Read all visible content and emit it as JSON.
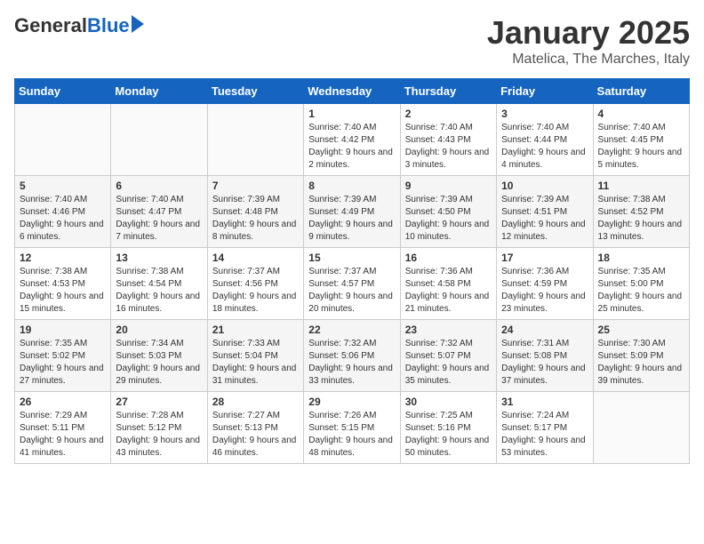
{
  "header": {
    "logo_general": "General",
    "logo_blue": "Blue",
    "month": "January 2025",
    "location": "Matelica, The Marches, Italy"
  },
  "weekdays": [
    "Sunday",
    "Monday",
    "Tuesday",
    "Wednesday",
    "Thursday",
    "Friday",
    "Saturday"
  ],
  "weeks": [
    [
      {
        "day": "",
        "info": ""
      },
      {
        "day": "",
        "info": ""
      },
      {
        "day": "",
        "info": ""
      },
      {
        "day": "1",
        "info": "Sunrise: 7:40 AM\nSunset: 4:42 PM\nDaylight: 9 hours and 2 minutes."
      },
      {
        "day": "2",
        "info": "Sunrise: 7:40 AM\nSunset: 4:43 PM\nDaylight: 9 hours and 3 minutes."
      },
      {
        "day": "3",
        "info": "Sunrise: 7:40 AM\nSunset: 4:44 PM\nDaylight: 9 hours and 4 minutes."
      },
      {
        "day": "4",
        "info": "Sunrise: 7:40 AM\nSunset: 4:45 PM\nDaylight: 9 hours and 5 minutes."
      }
    ],
    [
      {
        "day": "5",
        "info": "Sunrise: 7:40 AM\nSunset: 4:46 PM\nDaylight: 9 hours and 6 minutes."
      },
      {
        "day": "6",
        "info": "Sunrise: 7:40 AM\nSunset: 4:47 PM\nDaylight: 9 hours and 7 minutes."
      },
      {
        "day": "7",
        "info": "Sunrise: 7:39 AM\nSunset: 4:48 PM\nDaylight: 9 hours and 8 minutes."
      },
      {
        "day": "8",
        "info": "Sunrise: 7:39 AM\nSunset: 4:49 PM\nDaylight: 9 hours and 9 minutes."
      },
      {
        "day": "9",
        "info": "Sunrise: 7:39 AM\nSunset: 4:50 PM\nDaylight: 9 hours and 10 minutes."
      },
      {
        "day": "10",
        "info": "Sunrise: 7:39 AM\nSunset: 4:51 PM\nDaylight: 9 hours and 12 minutes."
      },
      {
        "day": "11",
        "info": "Sunrise: 7:38 AM\nSunset: 4:52 PM\nDaylight: 9 hours and 13 minutes."
      }
    ],
    [
      {
        "day": "12",
        "info": "Sunrise: 7:38 AM\nSunset: 4:53 PM\nDaylight: 9 hours and 15 minutes."
      },
      {
        "day": "13",
        "info": "Sunrise: 7:38 AM\nSunset: 4:54 PM\nDaylight: 9 hours and 16 minutes."
      },
      {
        "day": "14",
        "info": "Sunrise: 7:37 AM\nSunset: 4:56 PM\nDaylight: 9 hours and 18 minutes."
      },
      {
        "day": "15",
        "info": "Sunrise: 7:37 AM\nSunset: 4:57 PM\nDaylight: 9 hours and 20 minutes."
      },
      {
        "day": "16",
        "info": "Sunrise: 7:36 AM\nSunset: 4:58 PM\nDaylight: 9 hours and 21 minutes."
      },
      {
        "day": "17",
        "info": "Sunrise: 7:36 AM\nSunset: 4:59 PM\nDaylight: 9 hours and 23 minutes."
      },
      {
        "day": "18",
        "info": "Sunrise: 7:35 AM\nSunset: 5:00 PM\nDaylight: 9 hours and 25 minutes."
      }
    ],
    [
      {
        "day": "19",
        "info": "Sunrise: 7:35 AM\nSunset: 5:02 PM\nDaylight: 9 hours and 27 minutes."
      },
      {
        "day": "20",
        "info": "Sunrise: 7:34 AM\nSunset: 5:03 PM\nDaylight: 9 hours and 29 minutes."
      },
      {
        "day": "21",
        "info": "Sunrise: 7:33 AM\nSunset: 5:04 PM\nDaylight: 9 hours and 31 minutes."
      },
      {
        "day": "22",
        "info": "Sunrise: 7:32 AM\nSunset: 5:06 PM\nDaylight: 9 hours and 33 minutes."
      },
      {
        "day": "23",
        "info": "Sunrise: 7:32 AM\nSunset: 5:07 PM\nDaylight: 9 hours and 35 minutes."
      },
      {
        "day": "24",
        "info": "Sunrise: 7:31 AM\nSunset: 5:08 PM\nDaylight: 9 hours and 37 minutes."
      },
      {
        "day": "25",
        "info": "Sunrise: 7:30 AM\nSunset: 5:09 PM\nDaylight: 9 hours and 39 minutes."
      }
    ],
    [
      {
        "day": "26",
        "info": "Sunrise: 7:29 AM\nSunset: 5:11 PM\nDaylight: 9 hours and 41 minutes."
      },
      {
        "day": "27",
        "info": "Sunrise: 7:28 AM\nSunset: 5:12 PM\nDaylight: 9 hours and 43 minutes."
      },
      {
        "day": "28",
        "info": "Sunrise: 7:27 AM\nSunset: 5:13 PM\nDaylight: 9 hours and 46 minutes."
      },
      {
        "day": "29",
        "info": "Sunrise: 7:26 AM\nSunset: 5:15 PM\nDaylight: 9 hours and 48 minutes."
      },
      {
        "day": "30",
        "info": "Sunrise: 7:25 AM\nSunset: 5:16 PM\nDaylight: 9 hours and 50 minutes."
      },
      {
        "day": "31",
        "info": "Sunrise: 7:24 AM\nSunset: 5:17 PM\nDaylight: 9 hours and 53 minutes."
      },
      {
        "day": "",
        "info": ""
      }
    ]
  ]
}
